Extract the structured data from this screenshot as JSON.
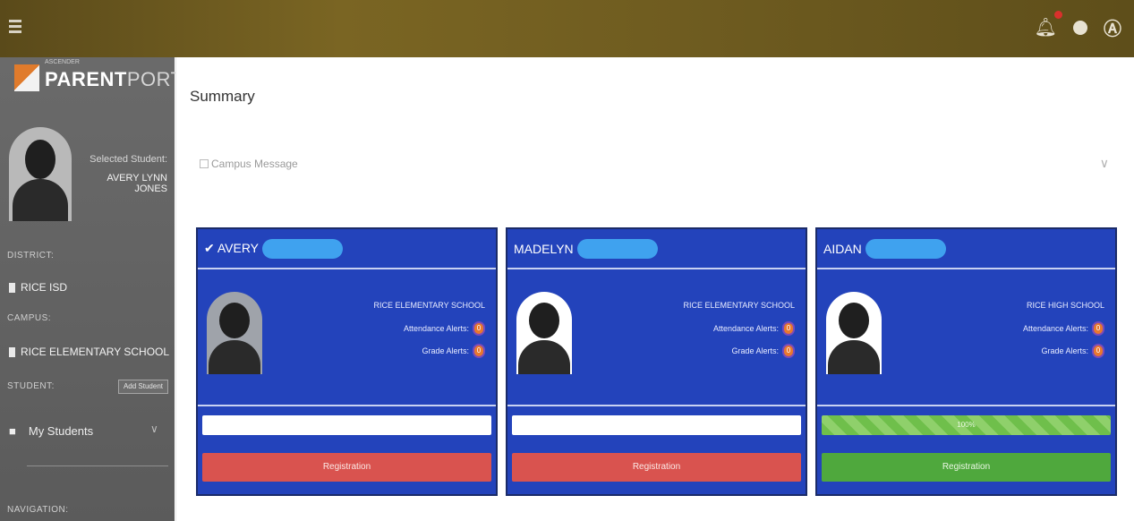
{
  "topbar": {
    "notification_count": 1,
    "icons": [
      "menu-icon",
      "bell-icon",
      "help-icon",
      "user-icon"
    ]
  },
  "sidebar": {
    "logo_small": "ASCENDER",
    "logo_bold": "PARENT",
    "logo_light": "PORTAL",
    "selected_student_label": "Selected Student:",
    "selected_student_name": "AVERY LYNN JONES",
    "district_label": "DISTRICT:",
    "district_value": "RICE ISD",
    "campus_label": "CAMPUS:",
    "campus_value": "RICE ELEMENTARY SCHOOL",
    "student_label": "STUDENT:",
    "add_student_label": "Add Student",
    "my_students_label": "My Students",
    "navigation_label": "NAVIGATION:"
  },
  "main": {
    "title": "Summary",
    "campus_message": "Campus Message"
  },
  "cards": [
    {
      "name": "✔ AVERY",
      "school": "RICE ELEMENTARY SCHOOL",
      "attendance_label": "Attendance Alerts:",
      "attendance_count": "0",
      "grade_label": "Grade Alerts:",
      "grade_count": "0",
      "progress_text": "",
      "progress_percent": 0,
      "registration_label": "Registration",
      "registration_color": "#d9534f"
    },
    {
      "name": "MADELYN",
      "school": "RICE ELEMENTARY SCHOOL",
      "attendance_label": "Attendance Alerts:",
      "attendance_count": "0",
      "grade_label": "Grade Alerts:",
      "grade_count": "0",
      "progress_text": "",
      "progress_percent": 0,
      "registration_label": "Registration",
      "registration_color": "#d9534f"
    },
    {
      "name": "AIDAN",
      "school": "RICE HIGH SCHOOL",
      "attendance_label": "Attendance Alerts:",
      "attendance_count": "0",
      "grade_label": "Grade Alerts:",
      "grade_count": "0",
      "progress_text": "100%",
      "progress_percent": 100,
      "registration_label": "Registration",
      "registration_color": "#4fa83d"
    }
  ]
}
